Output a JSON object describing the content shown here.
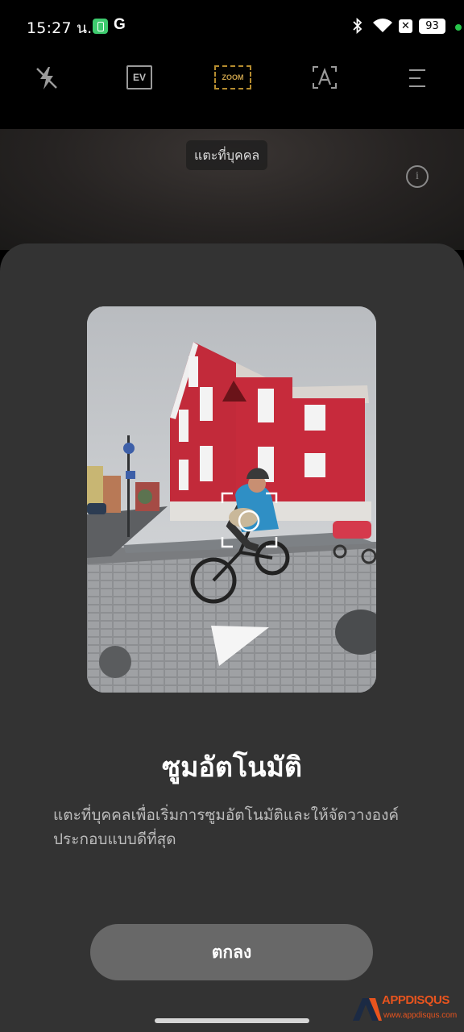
{
  "status_bar": {
    "time": "15:27 น.",
    "notif_g": "G",
    "battery": "93",
    "close_badge": "✕"
  },
  "camera_toolbar": {
    "ev_label": "EV",
    "zoom_label": "ZOOM",
    "auto_label": "A"
  },
  "viewfinder": {
    "hint": "แตะที่บุคคล",
    "info_glyph": "i"
  },
  "sheet": {
    "title": "ซูมอัตโนมัติ",
    "description": "แตะที่บุคคลเพื่อเริ่มการซูมอัตโนมัติและให้จัดวางองค์ประกอบแบบดีที่สุด",
    "ok_label": "ตกลง"
  },
  "watermark": {
    "logo": "APPDISQUS",
    "url": "www.appdisqus.com"
  },
  "colors": {
    "sheet_bg": "#333333",
    "button_bg": "#686868",
    "zoom_accent": "#c9a04a",
    "status_dot": "#27c44a"
  }
}
